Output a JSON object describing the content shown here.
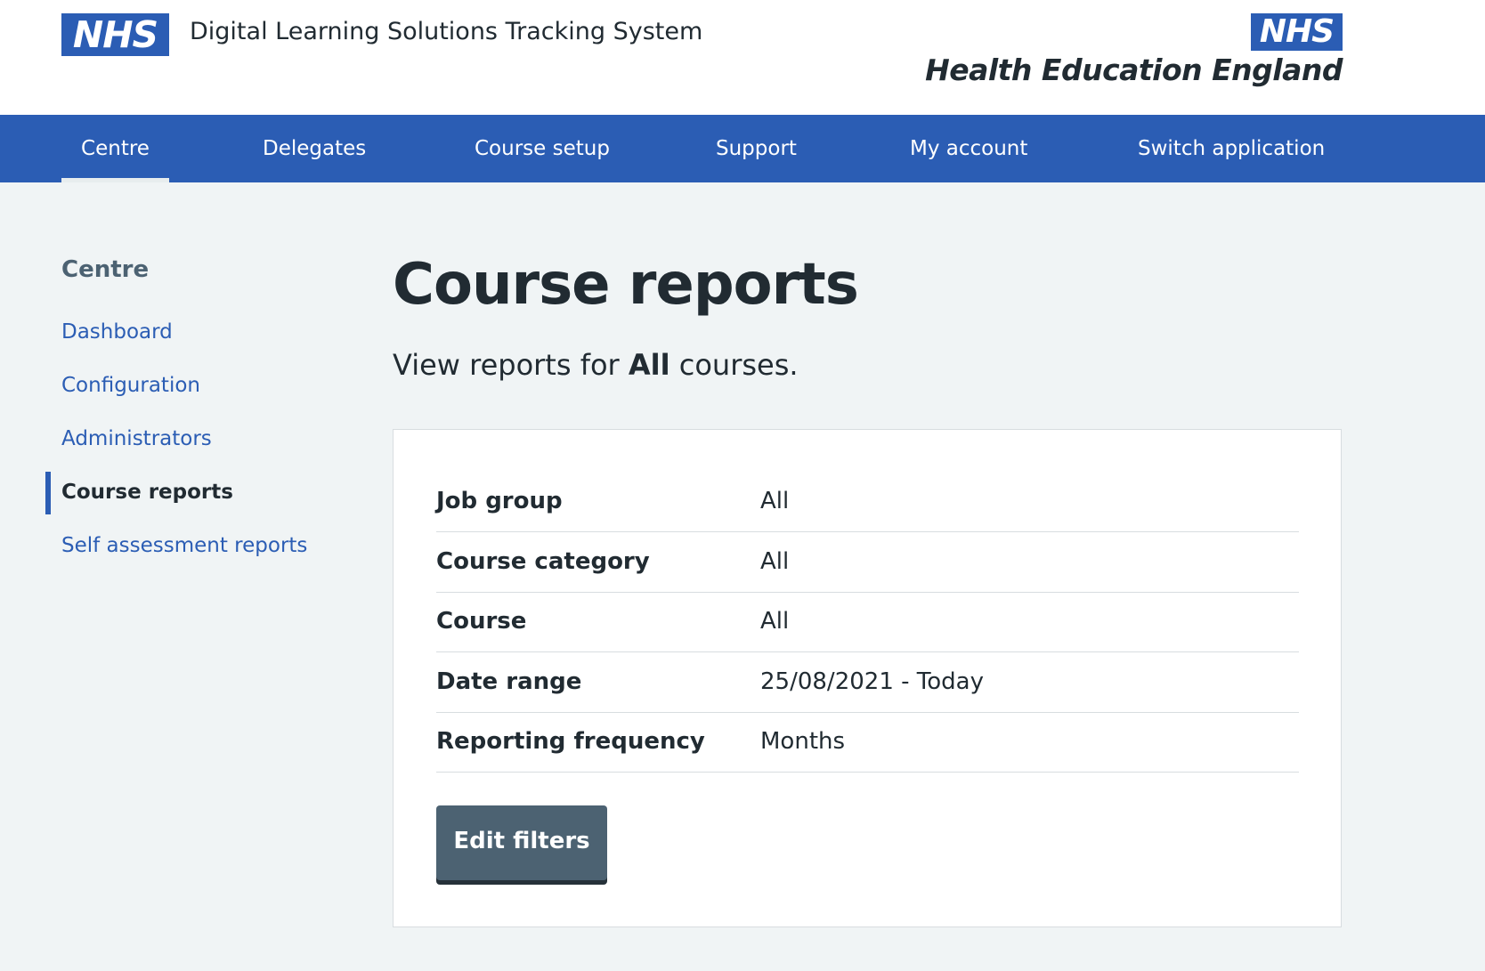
{
  "header": {
    "logo_text": "NHS",
    "service_name": "Digital Learning Solutions Tracking System",
    "partner_logo_nhs": "NHS",
    "partner_logo_text": "Health Education England"
  },
  "nav": {
    "items": [
      {
        "label": "Centre",
        "active": true
      },
      {
        "label": "Delegates"
      },
      {
        "label": "Course setup"
      },
      {
        "label": "Support"
      },
      {
        "label": "My account"
      },
      {
        "label": "Switch application"
      }
    ]
  },
  "sidebar": {
    "heading": "Centre",
    "items": [
      {
        "label": "Dashboard"
      },
      {
        "label": "Configuration"
      },
      {
        "label": "Administrators"
      },
      {
        "label": "Course reports",
        "current": true
      },
      {
        "label": "Self assessment reports"
      }
    ]
  },
  "main": {
    "title": "Course reports",
    "lead_prefix": "View reports for ",
    "lead_bold": "All",
    "lead_suffix": " courses.",
    "filters": [
      {
        "key": "Job group",
        "value": "All"
      },
      {
        "key": "Course category",
        "value": "All"
      },
      {
        "key": "Course",
        "value": "All"
      },
      {
        "key": "Date range",
        "value": "25/08/2021 - Today"
      },
      {
        "key": "Reporting frequency",
        "value": "Months"
      }
    ],
    "edit_button": "Edit filters"
  },
  "colors": {
    "brand_blue": "#2b5db4",
    "page_background": "#f0f4f5",
    "text": "#212b32",
    "secondary_button": "#4c6272"
  }
}
